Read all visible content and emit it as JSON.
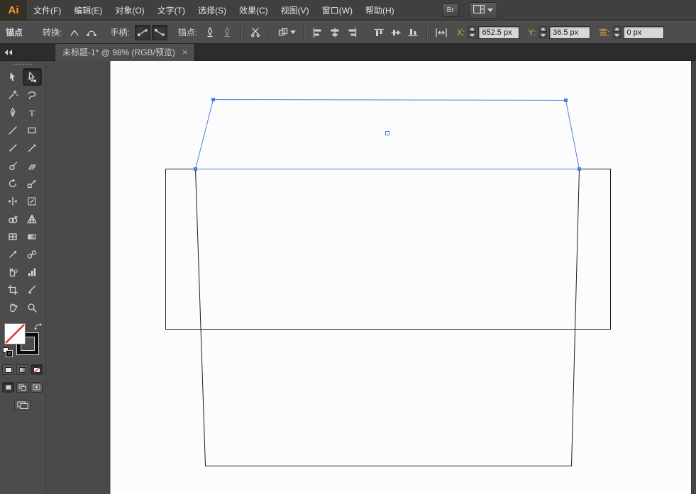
{
  "colors": {
    "menu_bg": "#404040",
    "panel_bg": "#4d4d4d",
    "dock_bg": "#494949",
    "canvas_bg": "#fcfcfc",
    "selection_blue": "#4a7fe0",
    "coordinate_label": "#e0a33c",
    "logo_orange": "#ff9b2d",
    "stroke_black": "#1c1c1c",
    "fill_none_slash_red": "#e03030"
  },
  "menu": {
    "logo": "Ai",
    "items": [
      "文件(F)",
      "编辑(E)",
      "对象(O)",
      "文字(T)",
      "选择(S)",
      "效果(C)",
      "视图(V)",
      "窗口(W)",
      "帮助(H)"
    ],
    "bridge": "Br"
  },
  "control": {
    "panel_label": "锚点",
    "convert_label": "转换:",
    "handles_label": "手柄:",
    "anchors_label": "锚点:",
    "x_label": "X:",
    "x_value": "652.5 px",
    "y_label": "Y:",
    "y_value": "36.5 px",
    "w_label": "宽:",
    "w_value": "0 px"
  },
  "tab": {
    "title": "未标题-1* @ 98% (RGB/预览)",
    "close": "×"
  },
  "toolbar": {
    "active_tool": "direct-selection-tool",
    "tools": [
      "selection-tool",
      "direct-selection-tool",
      "magic-wand-tool",
      "lasso-tool",
      "pen-tool",
      "type-tool",
      "line-segment-tool",
      "rectangle-tool",
      "paintbrush-tool",
      "pencil-tool",
      "blob-brush-tool",
      "eraser-tool",
      "rotate-tool",
      "scale-tool",
      "width-tool",
      "free-transform-tool",
      "shape-builder-tool",
      "perspective-grid-tool",
      "mesh-tool",
      "gradient-tool",
      "eyedropper-tool",
      "blend-tool",
      "symbol-sprayer-tool",
      "column-graph-tool",
      "artboard-tool",
      "slice-tool",
      "hand-tool",
      "zoom-tool"
    ],
    "type_tool_glyph": "T",
    "fill": "none",
    "stroke": "black"
  },
  "canvas_objects": {
    "description": "envelope template outline",
    "selected_object": "top-flap",
    "zoom": "98%"
  }
}
